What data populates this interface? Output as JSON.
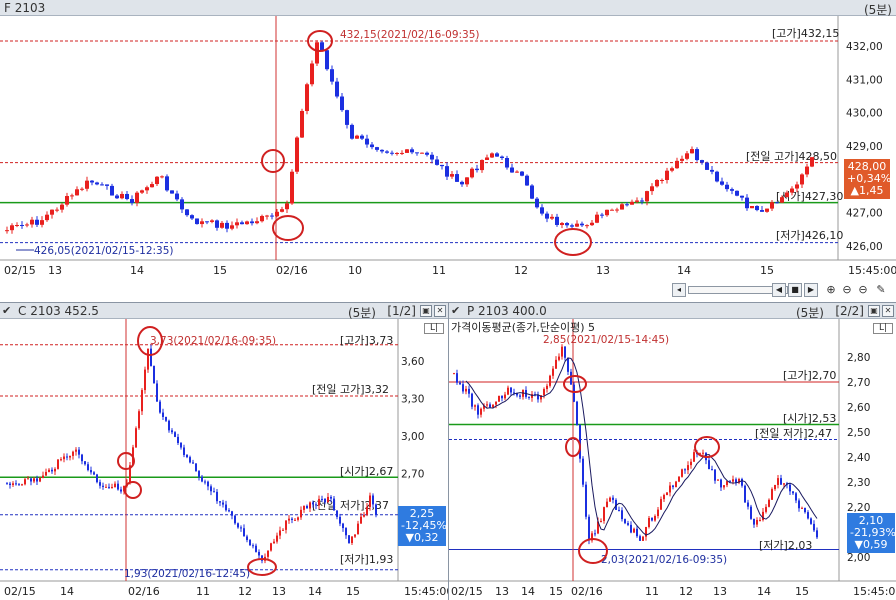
{
  "top": {
    "title": "F 2103",
    "interval": "(5분)",
    "y_ticks": [
      "432,00",
      "431,00",
      "430,00",
      "429,00",
      "428,00",
      "427,00",
      "426,00"
    ],
    "x_ticks": [
      "02/15",
      "13",
      "14",
      "15",
      "02/16",
      "10",
      "11",
      "12",
      "13",
      "14",
      "15",
      "15:45:00"
    ],
    "ref_high_label": "[고가]432,15",
    "ref_prev_high_label": "[전일 고가]428,50",
    "ref_open_label": "[시가]427,30",
    "ref_low_label": "[저가]426,10",
    "ann_high": "432,15(2021/02/16-09:35)",
    "ann_low": "426,05(2021/02/15-12:35)",
    "current": [
      "428,00",
      "+0,34%",
      "▲1,45"
    ]
  },
  "left": {
    "title": "C 2103 452.5",
    "interval": "(5분)",
    "page": "[1/2]",
    "y_ticks": [
      "3,60",
      "3,30",
      "3,00",
      "2,70",
      "2,40"
    ],
    "x_ticks": [
      "02/15",
      "14",
      "02/16",
      "11",
      "12",
      "13",
      "14",
      "15",
      "15:45:00"
    ],
    "ref_high_label": "[고가]3,73",
    "ref_prev_high_label": "[전일 고가]3,32",
    "ref_open_label": "[시가]2,67",
    "ref_prev_low_label": "[전일 저가]2,37",
    "ref_low_label": "[저가]1,93",
    "ann_high": "3,73(2021/02/16-09:35)",
    "ann_low": "1,93(2021/02/16-12:45)",
    "current": [
      "2,25",
      "-12,45%",
      "▼0,32"
    ]
  },
  "right": {
    "title": "P 2103 400.0",
    "interval": "(5분)",
    "page": "[2/2]",
    "indicator_label": "가격이동평균(종가,단순이평) 5",
    "y_ticks": [
      "2,80",
      "2,70",
      "2,60",
      "2,50",
      "2,40",
      "2,30",
      "2,20",
      "2,10",
      "2,00"
    ],
    "x_ticks": [
      "02/15",
      "13",
      "14",
      "15",
      "02/16",
      "11",
      "12",
      "13",
      "14",
      "15",
      "15:45:00"
    ],
    "ref_high_label": "[고가]2,70",
    "ref_open_label": "[시가]2,53",
    "ref_prev_low_label": "[전일 저가]2,47",
    "ref_low_label": "[저가]2,03",
    "ann_high": "2,85(2021/02/15-14:45)",
    "ann_low": "2,03(2021/02/16-09:35)",
    "current": [
      "2,10",
      "-21,93%",
      "▼0,59"
    ]
  },
  "toolbar": {
    "zoom_in": "⊕",
    "zoom_out": "⊖",
    "settings": "✎"
  },
  "colors": {
    "up": "#e8201e",
    "down": "#1b2fe0",
    "high_line": "#d02020",
    "open_line": "#1a9a1a",
    "low_line": "#2030c0",
    "current_up": "#e05a2a",
    "current_down": "#2f7be0"
  }
}
